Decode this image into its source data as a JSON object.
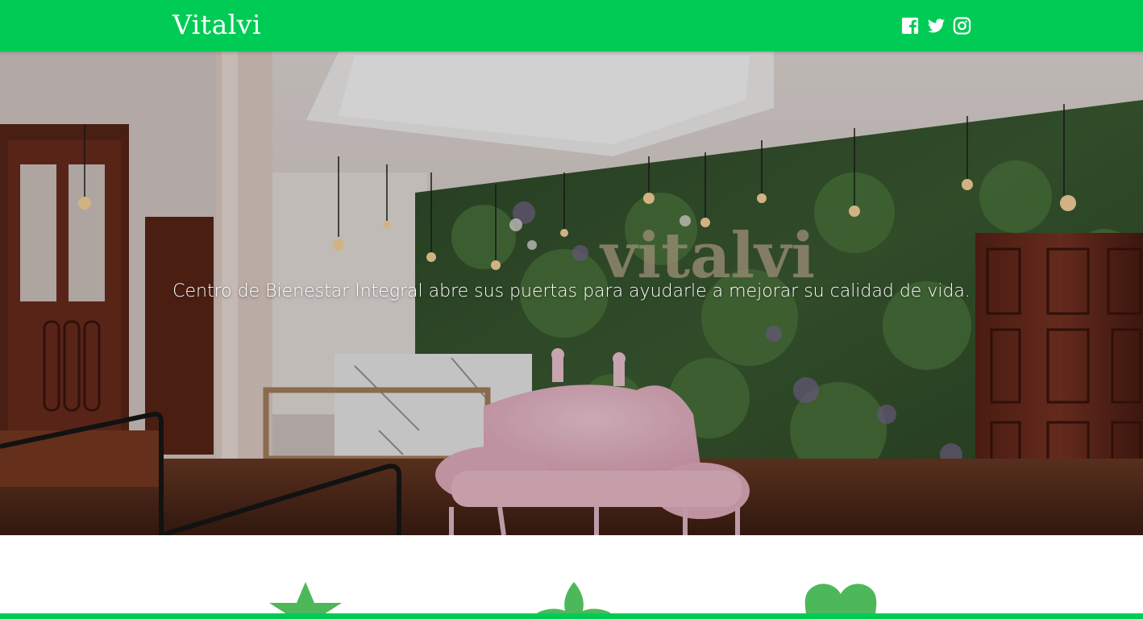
{
  "header": {
    "brand": "Vitalvi",
    "social": [
      {
        "name": "facebook",
        "icon": "facebook-square-icon"
      },
      {
        "name": "twitter",
        "icon": "twitter-icon"
      },
      {
        "name": "instagram",
        "icon": "instagram-icon"
      }
    ]
  },
  "hero": {
    "tagline": "Centro de Bienestar Integral abre sus puertas para ayudarle a mejorar su calidad de vida.",
    "wall_sign": "vitalvi"
  },
  "features": {
    "icons": [
      "star-icon",
      "leaf-icon",
      "heart-icon"
    ]
  },
  "colors": {
    "brand_green": "#00cc55",
    "icon_green": "#4db85a",
    "text_white": "#ffffff"
  }
}
